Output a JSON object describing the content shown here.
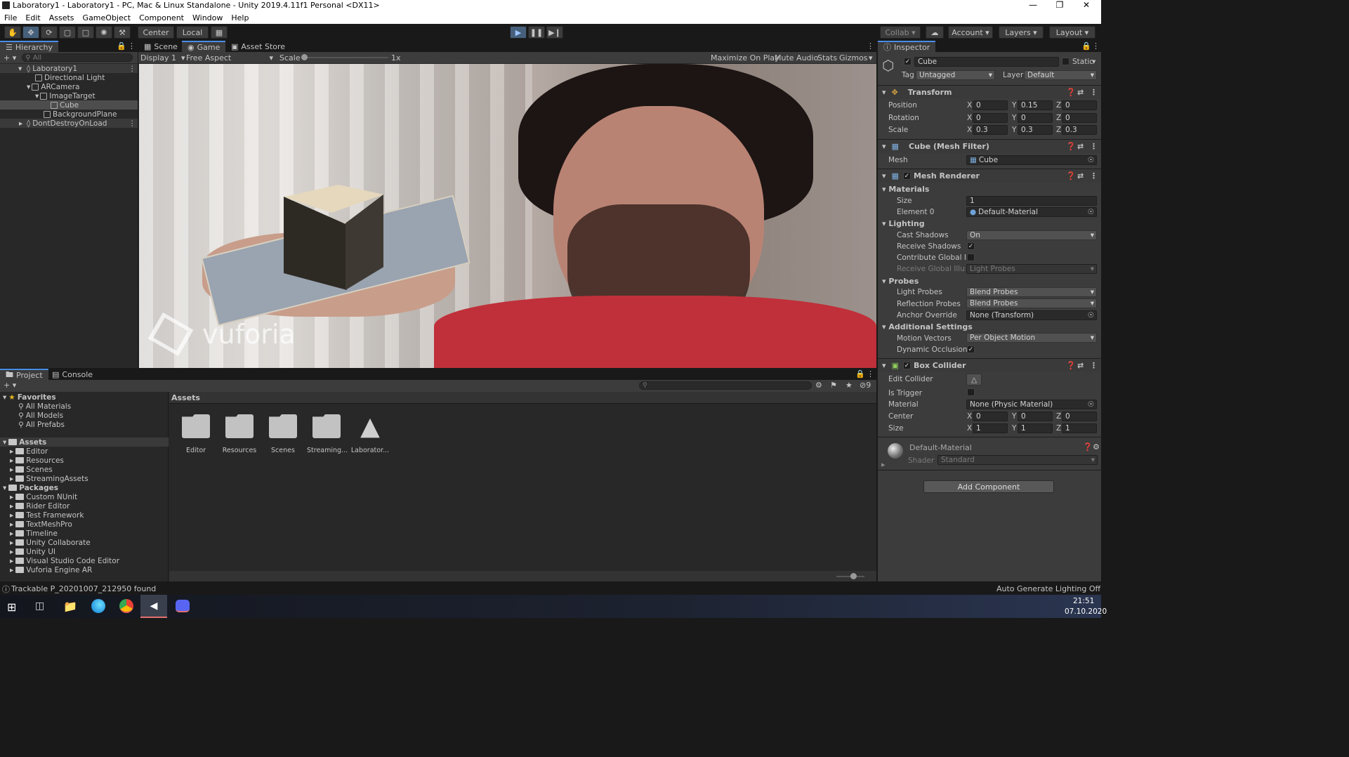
{
  "window": {
    "title": "Laboratory1 - Laboratory1 - PC, Mac & Linux Standalone - Unity 2019.4.11f1 Personal <DX11>"
  },
  "menu": [
    "File",
    "Edit",
    "Assets",
    "GameObject",
    "Component",
    "Window",
    "Help"
  ],
  "toolbar": {
    "center": "Center",
    "local": "Local",
    "collab": "Collab",
    "account": "Account",
    "layers": "Layers",
    "layout": "Layout"
  },
  "hierarchy": {
    "tab": "Hierarchy",
    "search_placeholder": "All",
    "items": [
      "Laboratory1",
      "Directional Light",
      "ARCamera",
      "ImageTarget",
      "Cube",
      "BackgroundPlane",
      "DontDestroyOnLoad"
    ]
  },
  "scene_tabs": {
    "scene": "Scene",
    "game": "Game",
    "asset_store": "Asset Store"
  },
  "game_bar": {
    "display": "Display 1",
    "aspect": "Free Aspect",
    "scale_label": "Scale",
    "scale_value": "1x",
    "maximize": "Maximize On Play",
    "mute": "Mute Audio",
    "stats": "Stats",
    "gizmos": "Gizmos"
  },
  "game_view": {
    "watermark": "vuforia"
  },
  "bottom_tabs": {
    "project": "Project",
    "console": "Console",
    "count": "9"
  },
  "project_tree": {
    "favorites": "Favorites",
    "fav_items": [
      "All Materials",
      "All Models",
      "All Prefabs"
    ],
    "assets": "Assets",
    "asset_items": [
      "Editor",
      "Resources",
      "Scenes",
      "StreamingAssets"
    ],
    "packages": "Packages",
    "package_items": [
      "Custom NUnit",
      "Rider Editor",
      "Test Framework",
      "TextMeshPro",
      "Timeline",
      "Unity Collaborate",
      "Unity UI",
      "Visual Studio Code Editor",
      "Vuforia Engine AR"
    ]
  },
  "assets_grid": {
    "breadcrumb": "Assets",
    "items": [
      "Editor",
      "Resources",
      "Scenes",
      "Streaming...",
      "Laborator..."
    ]
  },
  "inspector": {
    "tab": "Inspector",
    "object_name": "Cube",
    "static_label": "Static",
    "tag_label": "Tag",
    "tag": "Untagged",
    "layer_label": "Layer",
    "layer": "Default",
    "transform": {
      "title": "Transform",
      "position_label": "Position",
      "position": [
        "0",
        "0.15",
        "0"
      ],
      "rotation_label": "Rotation",
      "rotation": [
        "0",
        "0",
        "0"
      ],
      "scale_label": "Scale",
      "scale": [
        "0.3",
        "0.3",
        "0.3"
      ]
    },
    "mesh_filter": {
      "title": "Cube (Mesh Filter)",
      "mesh_label": "Mesh",
      "mesh": "Cube"
    },
    "mesh_renderer": {
      "title": "Mesh Renderer",
      "materials": "Materials",
      "size_label": "Size",
      "size": "1",
      "element0_label": "Element 0",
      "element0": "Default-Material",
      "lighting": "Lighting",
      "cast_shadows_label": "Cast Shadows",
      "cast_shadows": "On",
      "receive_shadows_label": "Receive Shadows",
      "contribute_gi_label": "Contribute Global Illui",
      "receive_gi_label": "Receive Global Illumi",
      "receive_gi": "Light Probes",
      "probes": "Probes",
      "light_probes_label": "Light Probes",
      "light_probes": "Blend Probes",
      "reflection_probes_label": "Reflection Probes",
      "reflection_probes": "Blend Probes",
      "anchor_override_label": "Anchor Override",
      "anchor_override": "None (Transform)",
      "additional": "Additional Settings",
      "motion_vectors_label": "Motion Vectors",
      "motion_vectors": "Per Object Motion",
      "dynamic_occlusion_label": "Dynamic Occlusion"
    },
    "box_collider": {
      "title": "Box Collider",
      "edit_label": "Edit Collider",
      "trigger_label": "Is Trigger",
      "material_label": "Material",
      "material": "None (Physic Material)",
      "center_label": "Center",
      "center": [
        "0",
        "0",
        "0"
      ],
      "size_label": "Size",
      "size": [
        "1",
        "1",
        "1"
      ]
    },
    "material": {
      "name": "Default-Material",
      "shader_label": "Shader",
      "shader": "Standard"
    },
    "add_component": "Add Component"
  },
  "status": {
    "message": "Trackable P_20201007_212950 found",
    "lighting": "Auto Generate Lighting Off"
  },
  "taskbar": {
    "time": "21:51",
    "date": "07.10.2020"
  }
}
